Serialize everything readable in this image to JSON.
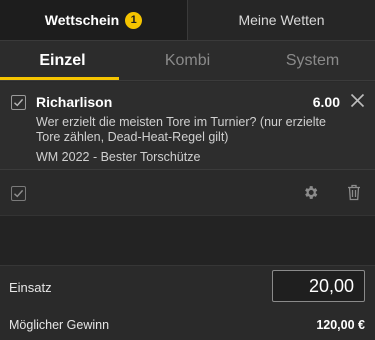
{
  "tabs": {
    "betslip_label": "Wettschein",
    "betslip_count": "1",
    "mybets_label": "Meine Wetten"
  },
  "subtabs": [
    {
      "label": "Einzel",
      "active": true
    },
    {
      "label": "Kombi",
      "active": false
    },
    {
      "label": "System",
      "active": false
    }
  ],
  "bet": {
    "selection": "Richarlison",
    "odds": "6.00",
    "market": "Wer erzielt die meisten Tore im Turnier? (nur erzielte Tore zählen, Dead-Heat-Regel gilt)",
    "event": "WM 2022 - Bester Torschütze",
    "checked": true
  },
  "icons": {
    "checkbox": "checkbox-icon",
    "close": "close-icon",
    "settings": "gear-icon",
    "delete": "trash-icon"
  },
  "stake": {
    "label": "Einsatz",
    "value": "20,00"
  },
  "winnings": {
    "label": "Möglicher Gewinn",
    "value": "120,00 €"
  },
  "colors": {
    "accent": "#f5c400",
    "background": "#2a2a2a"
  }
}
